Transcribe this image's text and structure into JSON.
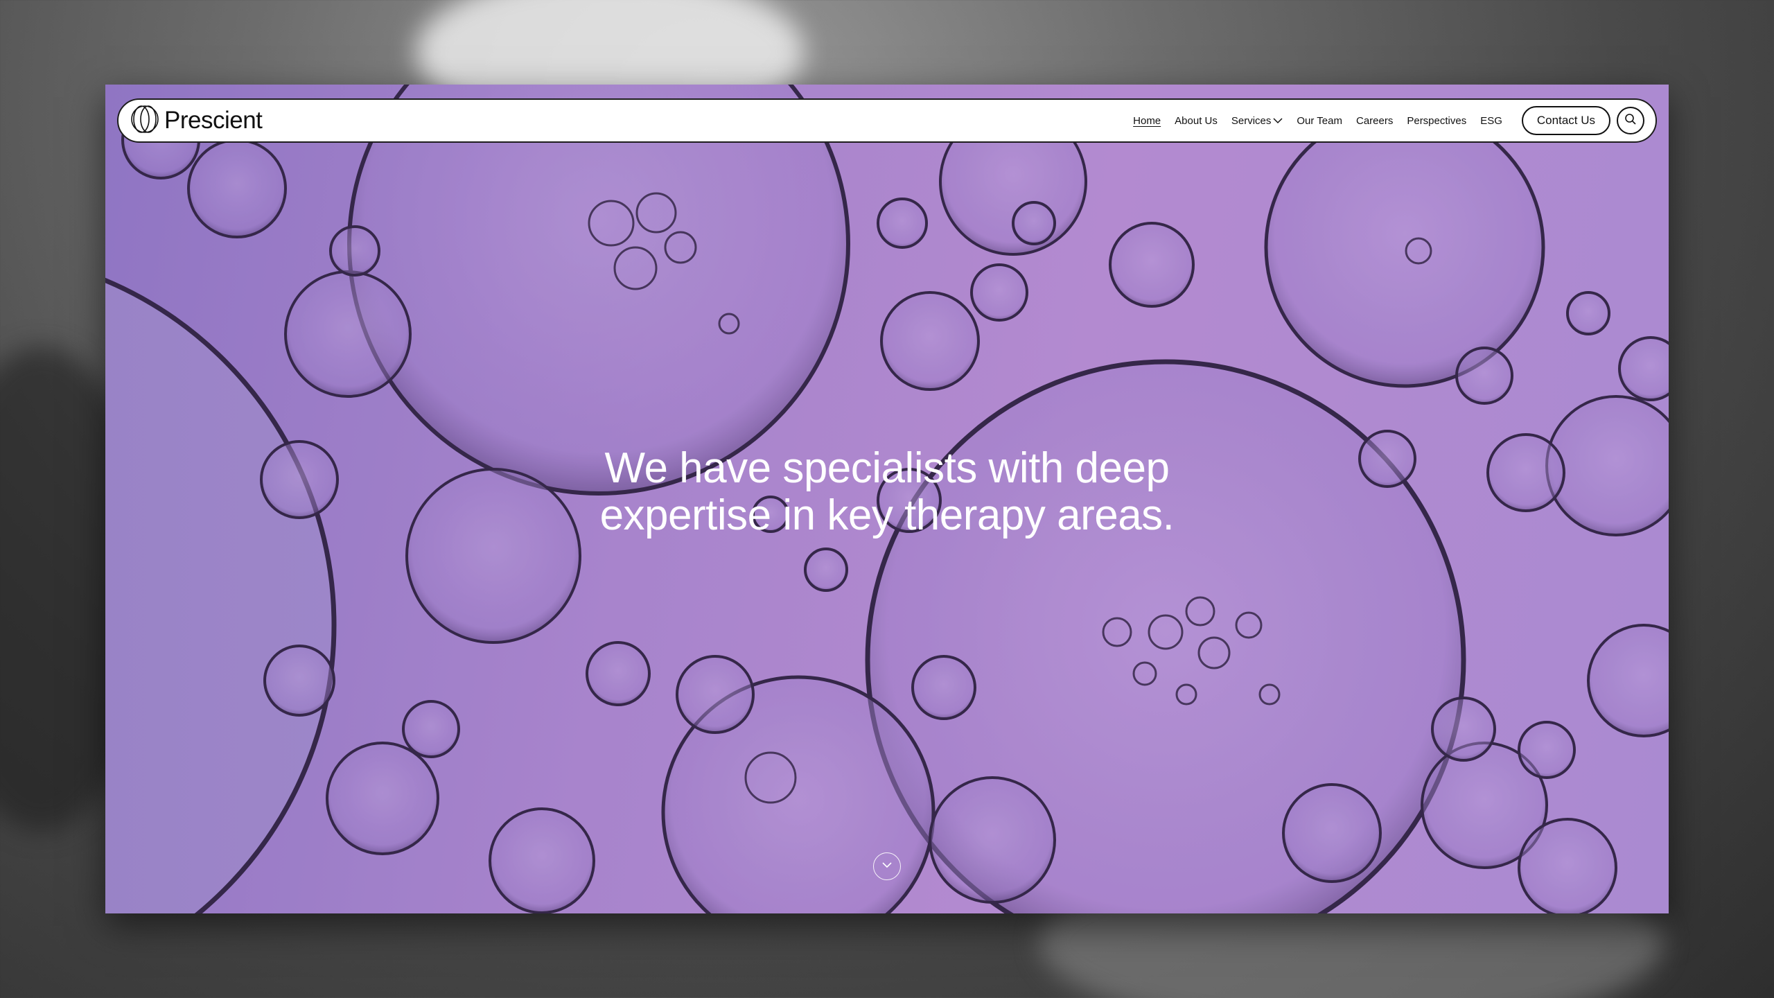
{
  "brand": {
    "name": "Prescient",
    "logo_icon": "intersecting-circles-logo"
  },
  "nav": {
    "items": [
      {
        "label": "Home",
        "active": true
      },
      {
        "label": "About Us"
      },
      {
        "label": "Services",
        "has_dropdown": true,
        "dropdown_icon": "chevron-down-icon"
      },
      {
        "label": "Our Team"
      },
      {
        "label": "Careers"
      },
      {
        "label": "Perspectives"
      },
      {
        "label": "ESG"
      }
    ],
    "contact_label": "Contact Us",
    "search_icon": "search-icon"
  },
  "hero": {
    "headline_line1": "We have specialists with deep",
    "headline_line2": "expertise in key therapy areas.",
    "background": "purple-bubbles-image",
    "scroll_icon": "chevron-down-circle-icon"
  },
  "colors": {
    "hero_purple": "#a684cb",
    "nav_bg": "#ffffff",
    "text_dark": "#111111",
    "text_light": "#ffffff",
    "backdrop_gray": "#4a4a4a"
  }
}
